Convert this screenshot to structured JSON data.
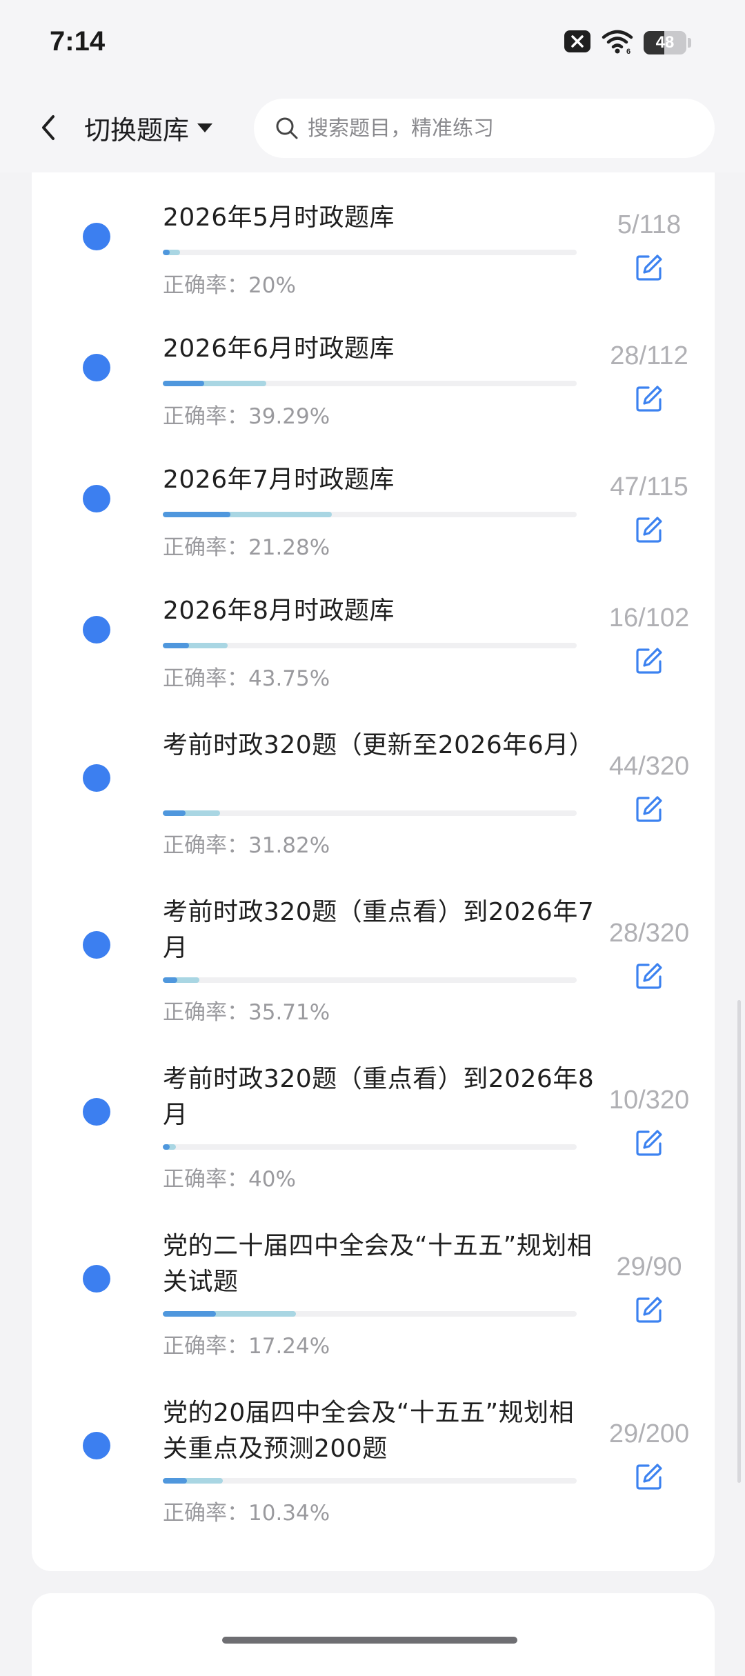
{
  "status_bar": {
    "time": "7:14",
    "battery_level": "48",
    "battery_fraction": 0.48,
    "icons": [
      "notification-off-icon",
      "wifi-icon",
      "battery-icon"
    ]
  },
  "nav": {
    "back_icon": "chevron-left-icon",
    "switch_label": "切换题库",
    "switch_icon": "caret-down-icon",
    "search_placeholder": "搜索题目，精准练习",
    "search_icon": "search-icon"
  },
  "colors": {
    "dot": "#3c7ff0",
    "progress_done": "#a9d6e3",
    "progress_accuracy": "#4f97dd",
    "edit_icon": "#3c82f0",
    "count_text": "#b0b0b4"
  },
  "banks": [
    {
      "title": "2026年5月时政题库",
      "accuracy_label": "正确率：20%",
      "count": "5/118",
      "answered_fraction": 0.042,
      "accuracy_fraction": 0.2
    },
    {
      "title": "2026年6月时政题库",
      "accuracy_label": "正确率：39.29%",
      "count": "28/112",
      "answered_fraction": 0.25,
      "accuracy_fraction": 0.3929
    },
    {
      "title": "2026年7月时政题库",
      "accuracy_label": "正确率：21.28%",
      "count": "47/115",
      "answered_fraction": 0.409,
      "accuracy_fraction": 0.2128
    },
    {
      "title": "2026年8月时政题库",
      "accuracy_label": "正确率：43.75%",
      "count": "16/102",
      "answered_fraction": 0.157,
      "accuracy_fraction": 0.4375
    },
    {
      "title": "考前时政320题（更新至2026年6月）",
      "accuracy_label": "正确率：31.82%",
      "count": "44/320",
      "answered_fraction": 0.1375,
      "accuracy_fraction": 0.3182
    },
    {
      "title": "考前时政320题（重点看）到2026年7月",
      "accuracy_label": "正确率：35.71%",
      "count": "28/320",
      "answered_fraction": 0.0875,
      "accuracy_fraction": 0.3571
    },
    {
      "title": "考前时政320题（重点看）到2026年8月",
      "accuracy_label": "正确率：40%",
      "count": "10/320",
      "answered_fraction": 0.03125,
      "accuracy_fraction": 0.4
    },
    {
      "title": "党的二十届四中全会及“十五五”规划相关试题",
      "accuracy_label": "正确率：17.24%",
      "count": "29/90",
      "answered_fraction": 0.322,
      "accuracy_fraction": 0.1724
    },
    {
      "title": "党的20届四中全会及“十五五”规划相关重点及预测200题",
      "accuracy_label": "正确率：10.34%",
      "count": "29/200",
      "answered_fraction": 0.145,
      "accuracy_fraction": 0.1034
    }
  ]
}
